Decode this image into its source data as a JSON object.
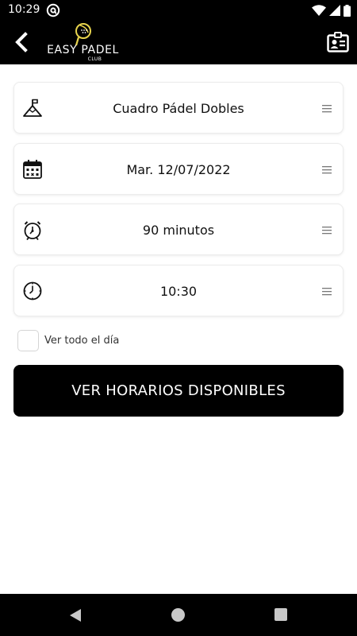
{
  "status_bar": {
    "time": "10:29",
    "icons": [
      "at-sign-icon",
      "wifi-icon",
      "cellular-signal-icon",
      "battery-icon"
    ]
  },
  "app_bar": {
    "brand_name": "EASY PADEL",
    "brand_sub": "CLUB",
    "back_icon": "chevron-left-icon",
    "profile_icon": "id-card-icon"
  },
  "booking": {
    "fields": [
      {
        "icon": "flag-peak-icon",
        "value": "Cuadro Pádel Dobles"
      },
      {
        "icon": "calendar-icon",
        "value": "Mar. 12/07/2022"
      },
      {
        "icon": "stopwatch-icon",
        "value": "90 minutos"
      },
      {
        "icon": "clock-icon",
        "value": "10:30"
      }
    ],
    "full_day_label": "Ver todo el día",
    "full_day_checked": false,
    "submit_label": "VER HORARIOS DISPONIBLES"
  },
  "colors": {
    "bar_background": "#000000",
    "accent": "#e8d44d",
    "button_background": "#000000",
    "button_text": "#ffffff"
  }
}
